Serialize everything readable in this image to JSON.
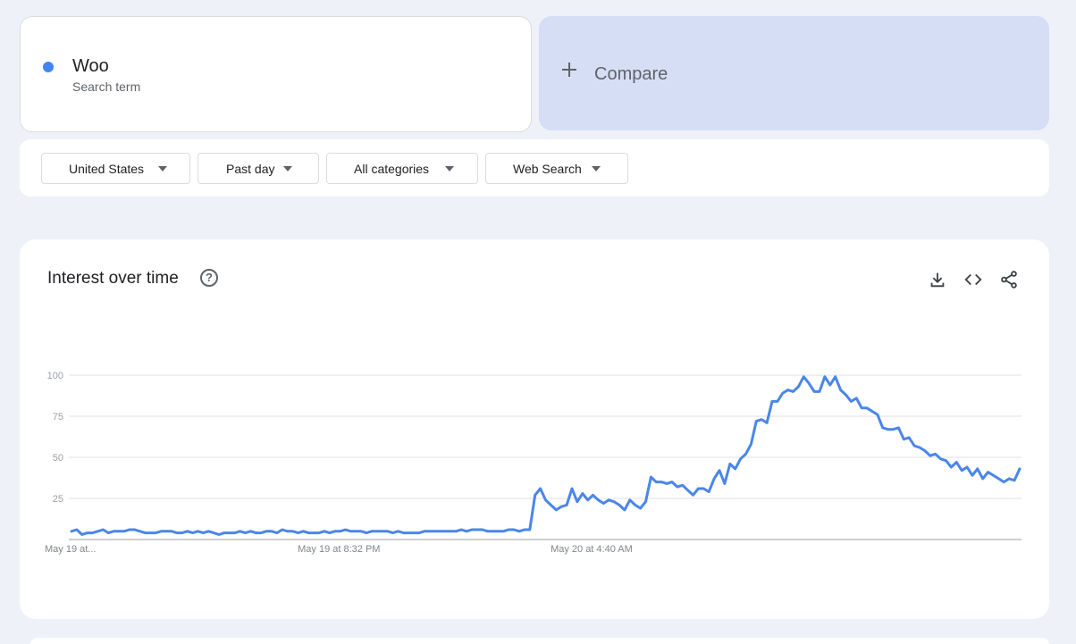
{
  "term": {
    "name": "Woo",
    "subtitle": "Search term",
    "color": "#4285f4"
  },
  "compare": {
    "label": "Compare",
    "icon": "plus-icon"
  },
  "filters": [
    {
      "label": "United States"
    },
    {
      "label": "Past day"
    },
    {
      "label": "All categories"
    },
    {
      "label": "Web Search"
    }
  ],
  "panel": {
    "title": "Interest over time",
    "help_icon_glyph": "?",
    "icons": [
      "download-icon",
      "embed-icon",
      "share-icon"
    ]
  },
  "chart_data": {
    "type": "line",
    "title": "",
    "xlabel": "",
    "ylabel": "",
    "ylim": [
      0,
      100
    ],
    "yticks": [
      25,
      50,
      75,
      100
    ],
    "grid": true,
    "x_tick_labels": [
      "May 19 at...",
      "May 19 at 8:32 PM",
      "May 20 at 4:40 AM"
    ],
    "x_tick_index": [
      0,
      46,
      94
    ],
    "series": [
      {
        "color": "#4a86e8",
        "values": [
          5,
          6,
          3,
          4,
          4,
          5,
          6,
          4,
          5,
          5,
          5,
          6,
          6,
          5,
          4,
          4,
          4,
          5,
          5,
          5,
          4,
          4,
          5,
          4,
          5,
          4,
          5,
          4,
          3,
          4,
          4,
          4,
          5,
          4,
          5,
          4,
          4,
          5,
          5,
          4,
          6,
          5,
          5,
          4,
          5,
          4,
          4,
          4,
          5,
          4,
          5,
          5,
          6,
          5,
          5,
          5,
          4,
          5,
          5,
          5,
          5,
          4,
          5,
          4,
          4,
          4,
          4,
          5,
          5,
          5,
          5,
          5,
          5,
          5,
          6,
          5,
          6,
          6,
          6,
          5,
          5,
          5,
          5,
          6,
          6,
          5,
          6,
          6,
          27,
          31,
          24,
          21,
          18,
          20,
          21,
          31,
          23,
          28,
          24,
          27,
          24,
          22,
          24,
          23,
          21,
          18,
          24,
          21,
          19,
          23,
          38,
          35,
          35,
          34,
          35,
          32,
          33,
          30,
          27,
          31,
          31,
          29,
          37,
          42,
          34,
          46,
          43,
          49,
          52,
          58,
          72,
          73,
          71,
          84,
          84,
          89,
          91,
          90,
          93,
          99,
          95,
          90,
          90,
          99,
          94,
          99,
          91,
          88,
          84,
          86,
          80,
          80,
          78,
          76,
          68,
          67,
          67,
          68,
          61,
          62,
          57,
          56,
          54,
          51,
          52,
          49,
          48,
          44,
          47,
          42,
          44,
          39,
          43,
          37,
          41,
          39,
          37,
          35,
          37,
          36,
          43
        ]
      }
    ]
  }
}
